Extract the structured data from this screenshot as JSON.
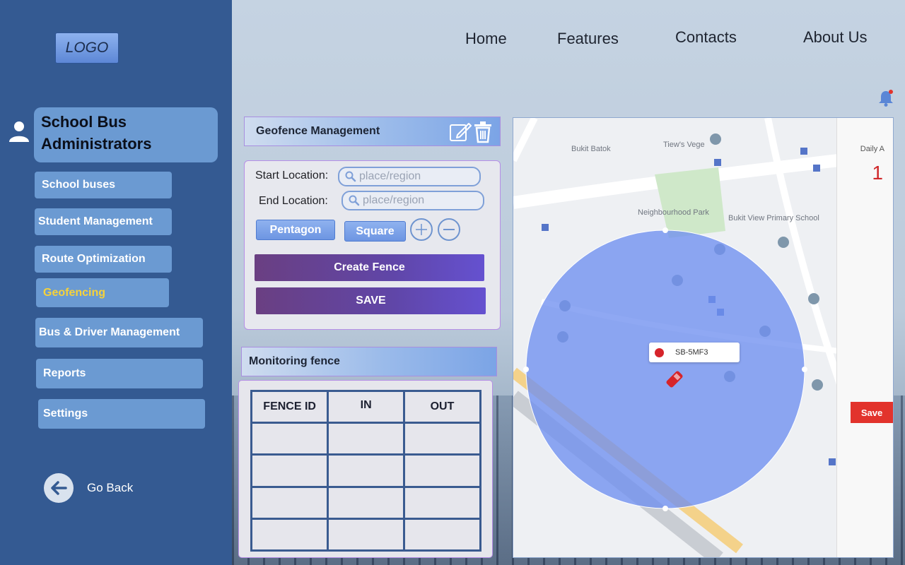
{
  "app": {
    "logo": "LOGO"
  },
  "topnav": {
    "items": [
      "Home",
      "Features",
      "Contacts",
      "About Us"
    ]
  },
  "sidebar": {
    "title_line1": "School Bus",
    "title_line2": "Administrators",
    "items": [
      {
        "label": "School buses"
      },
      {
        "label": "Student Management"
      },
      {
        "label": "Route Optimization"
      },
      {
        "label": "Geofencing",
        "active": true
      },
      {
        "label": "Bus & Driver Management"
      },
      {
        "label": "Reports"
      },
      {
        "label": "Settings"
      }
    ],
    "go_back": "Go Back"
  },
  "geofence": {
    "title": "Geofence Management",
    "start_label": "Start Location:",
    "end_label": "End Location:",
    "placeholder": "place/region",
    "shapes": [
      "Pentagon",
      "Square"
    ],
    "create_label": "Create Fence",
    "save_label": "SAVE"
  },
  "monitoring": {
    "title": "Monitoring fence",
    "columns": [
      "FENCE ID",
      "IN",
      "OUT"
    ],
    "rows": [
      [
        "",
        "",
        ""
      ],
      [
        "",
        "",
        ""
      ],
      [
        "",
        "",
        ""
      ],
      [
        "",
        "",
        ""
      ]
    ]
  },
  "map": {
    "daily_label": "Daily A",
    "daily_value": "1",
    "vehicle_label": "SB-5MF3",
    "save_label": "Save",
    "fence_color": "#6f8ff0"
  },
  "colors": {
    "sidebar_bg": "#345a92",
    "nav_button": "#6b9ad2",
    "active_text": "#f6d23a",
    "action_button": "#6046a8"
  }
}
